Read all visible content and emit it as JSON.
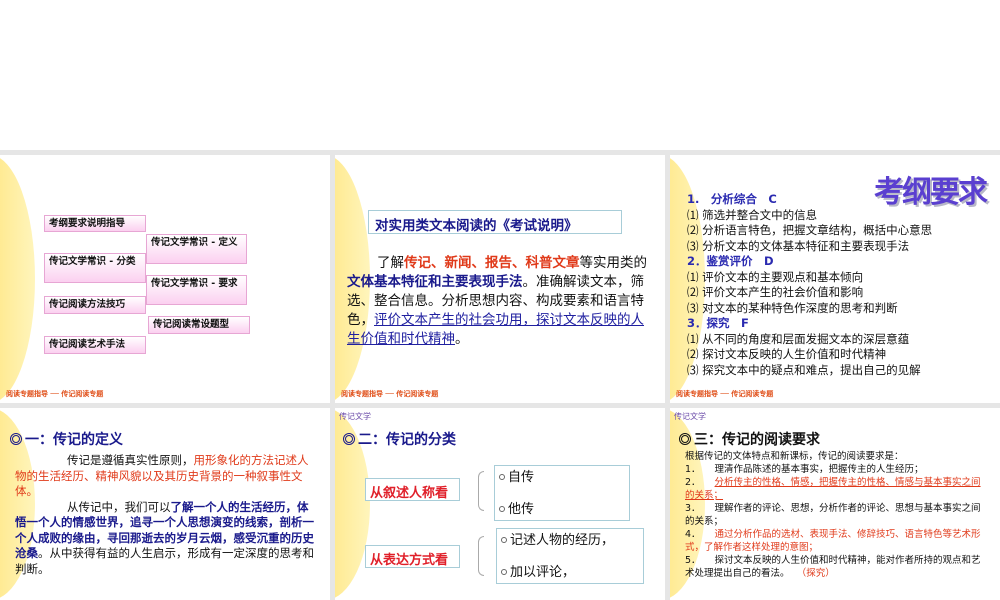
{
  "footer": "阅读专题指导 ── 传记阅读专题",
  "tag": "传记文学",
  "slide1": {
    "boxes": [
      "考纲要求说明指导",
      "传记文学常识 - 定义",
      "传记文学常识 - 分类",
      "传记文学常识 - 要求",
      "传记阅读方法技巧",
      "传记阅读常设题型",
      "传记阅读艺术手法"
    ]
  },
  "slide2": {
    "title": "对实用类文本阅读的《考试说明》",
    "p1": "了解",
    "p2": "传记、新闻、报告、科普文章",
    "p3": "等实用类的",
    "p4": "文体基本特征和主要表现手法",
    "p5": "。准确解读文本，筛选、整合信息。分析思想内容、构成要素和语言特色，",
    "p6": "评价文本产生的社会功用，探讨文本反映的人生价值和时代精神",
    "p7": "。"
  },
  "slide3": {
    "title": "考纲要求",
    "lines": [
      {
        "t": "1.　分析综合　C",
        "h": true
      },
      {
        "t": "⑴ 筛选并整合文中的信息"
      },
      {
        "t": "⑵ 分析语言特色，把握文章结构，概括中心意思"
      },
      {
        "t": "⑶ 分析文本的文体基本特征和主要表现手法"
      },
      {
        "t": "2．鉴赏评价　D",
        "h": true
      },
      {
        "t": "⑴ 评价文本的主要观点和基本倾向"
      },
      {
        "t": "⑵ 评价文本产生的社会价值和影响"
      },
      {
        "t": "⑶ 对文本的某种特色作深度的思考和判断"
      },
      {
        "t": "3．探究　F",
        "h": true
      },
      {
        "t": "⑴ 从不同的角度和层面发掘文本的深层意蕴"
      },
      {
        "t": "⑵ 探讨文本反映的人生价值和时代精神"
      },
      {
        "t": "⑶ 探究文本中的疑点和难点，提出自己的见解"
      }
    ]
  },
  "slide4": {
    "title": "一：传记的定义",
    "a1": "传记是遵循真实性原则，",
    "a2": "用形象化的方法记述人物的生活经历、精神风貌以及其历史背景的一种叙事性文体。",
    "b1": "从传记中，我们可以",
    "b2": "了解一个人的生活经历，体悟一个人的情感世界，追寻一个人思想演变的线索，剖析一个人成败的缘由，寻回那逝去的岁月云烟，感受沉重的历史沧桑",
    "b3": "。从中获得有益的人生启示，形成有一定深度的思考和判断。"
  },
  "slide5": {
    "title": "二：传记的分类",
    "label1": "从叙述人称看",
    "items1": [
      "自传",
      "他传"
    ],
    "label2": "从表达方式看",
    "items2": [
      "记述人物的经历，",
      "加以评论，"
    ]
  },
  "slide6": {
    "title": "三：传记的阅读要求",
    "intro": "根据传记的文体特点和新课标，传记的阅读要求是：",
    "items": [
      {
        "n": "1．",
        "t": "理清作品陈述的基本事实，把握传主的人生经历；",
        "red": false
      },
      {
        "n": "2．",
        "t": "分析传主的性格、情感，把握传主的性格、情感与基本事实之间的关系；",
        "red": true
      },
      {
        "n": "3．",
        "t": "理解作者的评论、思想，分析作者的评论、思想与基本事实之间的关系；",
        "red": false
      },
      {
        "n": "4．",
        "t": "通过分析作品的选材、表现手法、修辞技巧、语言特色等艺术形式，了解作者这样处理的意图；",
        "red": true
      },
      {
        "n": "5．",
        "t": "探讨文本反映的人生价值和时代精神，能对作者所持的观点和艺术处理提出自己的看法。",
        "red": false
      }
    ],
    "tail": "（探究）"
  }
}
